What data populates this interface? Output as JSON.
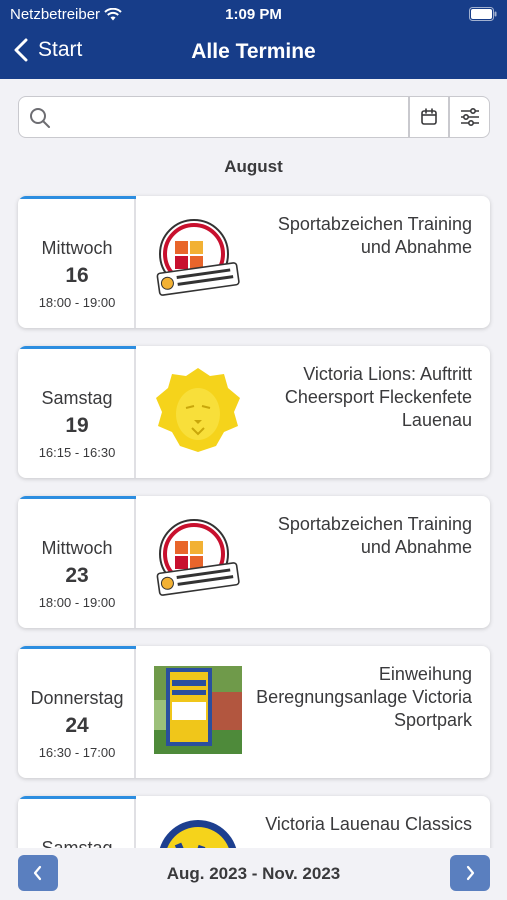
{
  "status_bar": {
    "carrier": "Netzbetreiber",
    "time": "1:09 PM"
  },
  "nav": {
    "back_label": "Start",
    "title": "Alle Termine"
  },
  "search": {
    "placeholder": "",
    "value": ""
  },
  "month_label": "August",
  "events": [
    {
      "weekday": "Mittwoch",
      "day": "16",
      "time": "18:00 - 19:00",
      "title": "Sportabzeichen Training und Abnahme",
      "image": "sportabzeichen-logo"
    },
    {
      "weekday": "Samstag",
      "day": "19",
      "time": "16:15 - 16:30",
      "title": "Victoria Lions: Auftritt Cheersport Fleckenfete Lauenau",
      "image": "lion-logo"
    },
    {
      "weekday": "Mittwoch",
      "day": "23",
      "time": "18:00 - 19:00",
      "title": "Sportabzeichen Training und Abnahme",
      "image": "sportabzeichen-logo"
    },
    {
      "weekday": "Donnerstag",
      "day": "24",
      "time": "16:30 - 17:00",
      "title": "Einweihung Beregnungsanlage Victoria Sportpark",
      "image": "sportpark-photo"
    },
    {
      "weekday": "Samstag",
      "day": "",
      "time": "",
      "title": "Victoria Lauenau Classics",
      "image": "victoria-logo"
    }
  ],
  "footer": {
    "range": "Aug. 2023 - Nov. 2023"
  },
  "colors": {
    "header": "#173d89",
    "accent": "#2d8ee0",
    "nav_button": "#5a7fbf",
    "background": "#f2f2f6"
  }
}
